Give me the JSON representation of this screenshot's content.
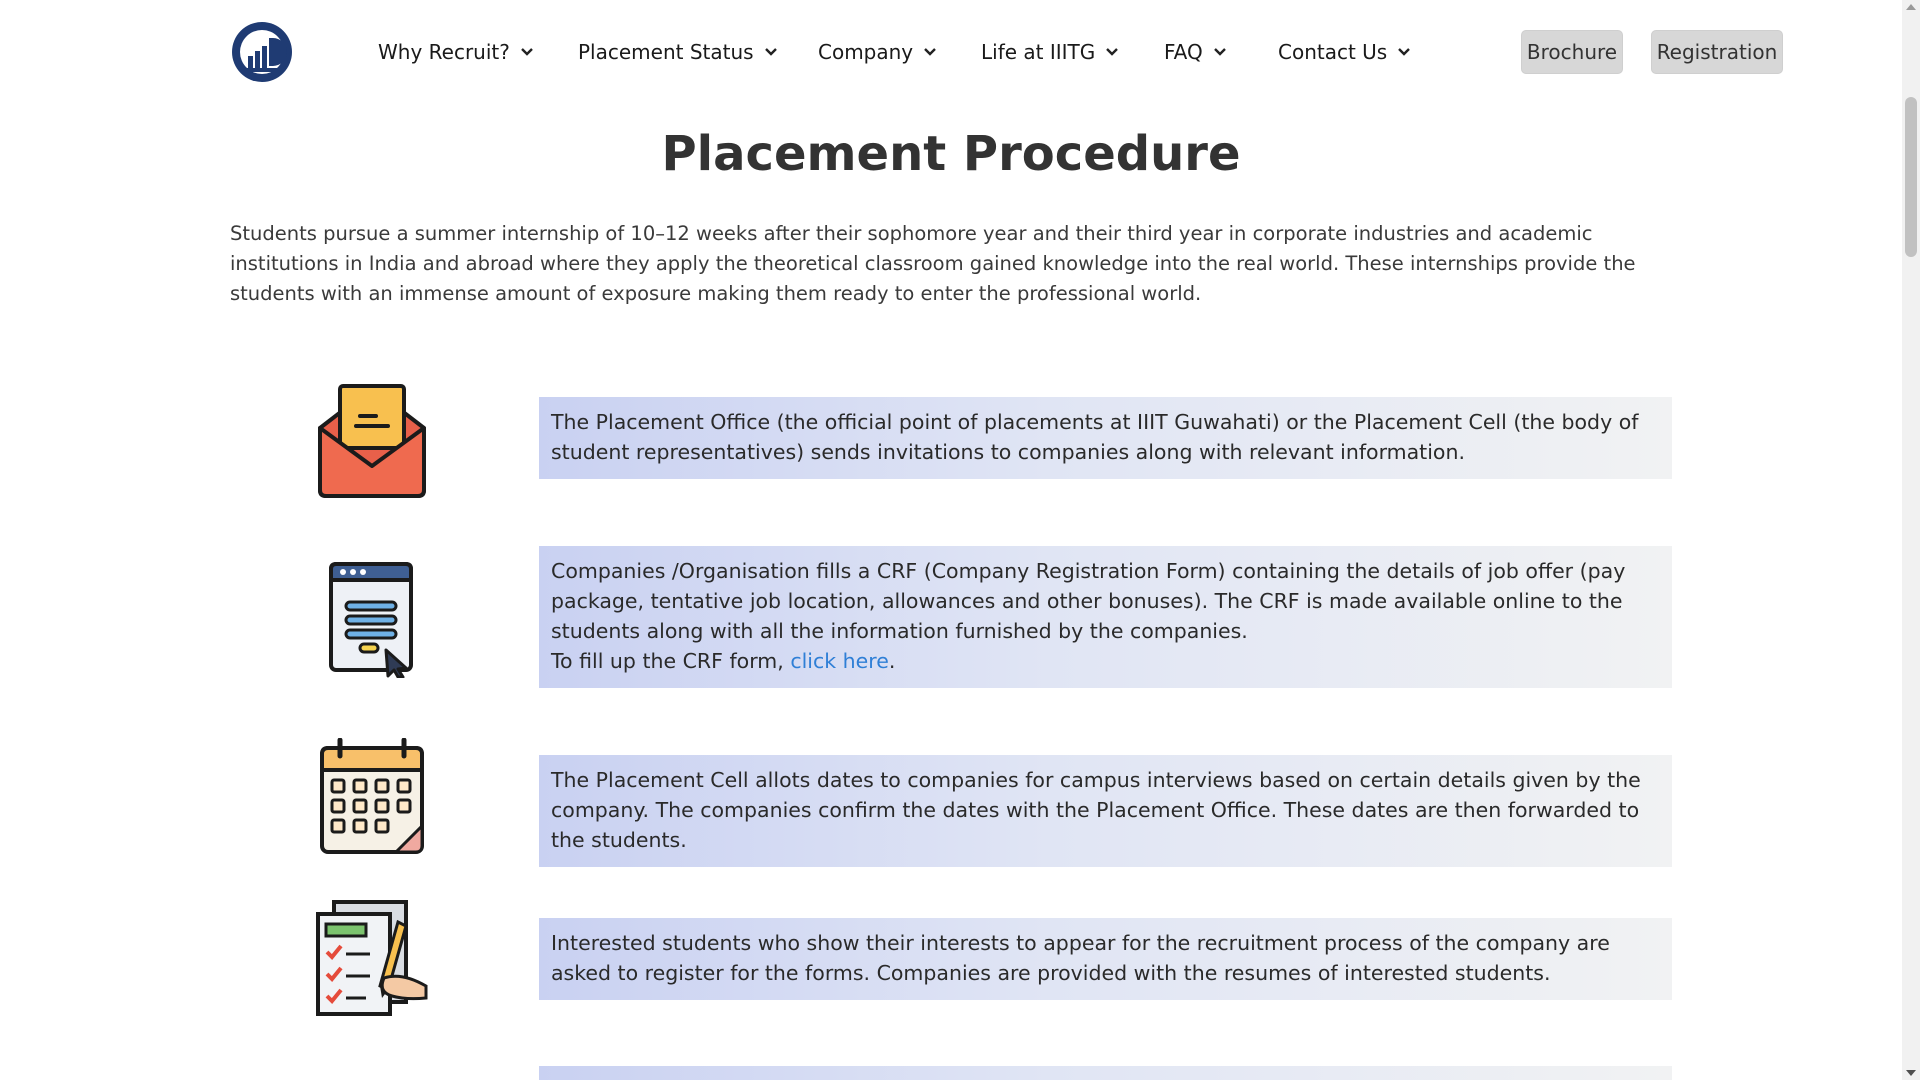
{
  "nav": {
    "items": [
      {
        "label": "Why Recruit?"
      },
      {
        "label": "Placement Status"
      },
      {
        "label": "Company"
      },
      {
        "label": "Life at IIITG"
      },
      {
        "label": "FAQ"
      },
      {
        "label": "Contact Us"
      }
    ],
    "brochure_label": "Brochure",
    "registration_label": "Registration"
  },
  "page": {
    "title": "Placement Procedure",
    "intro": "Students pursue a summer internship of 10–12 weeks after their sophomore year and their third year in corporate industries and academic institutions in India and abroad where they apply the theoretical classroom gained knowledge into the real world. These internships provide the students with an immense amount of exposure making them ready to enter the professional world."
  },
  "steps": [
    {
      "icon": "envelope-icon",
      "text": "The Placement Office (the official point of placements at IIIT Guwahati) or the Placement Cell (the body of student representatives) sends invitations to companies along with relevant information."
    },
    {
      "icon": "form-icon",
      "text": "Companies /Organisation fills a CRF (Company Registration Form) containing the details of job offer (pay package, tentative job location, allowances and other bonuses). The CRF is made available online to the students along with all the information furnished by the companies.",
      "crf_prefix": "To fill up the CRF form,",
      "crf_link": "click here",
      "crf_suffix": "."
    },
    {
      "icon": "calendar-icon",
      "text": "The Placement Cell allots dates to companies for campus interviews based on certain details given by the company. The companies confirm the dates with the Placement Office. These dates are then forwarded to the students."
    },
    {
      "icon": "checklist-icon",
      "text": "Interested students who show their interests to appear for the recruitment process of the company are asked to register for the forms. Companies are provided with the resumes of interested students."
    }
  ],
  "colors": {
    "brand": "#1f3b73",
    "link": "#2f7fd6",
    "box_gradient_start": "#c9d1f2",
    "box_gradient_end": "#f1f2f3",
    "button_bg": "#d7d7d7"
  }
}
